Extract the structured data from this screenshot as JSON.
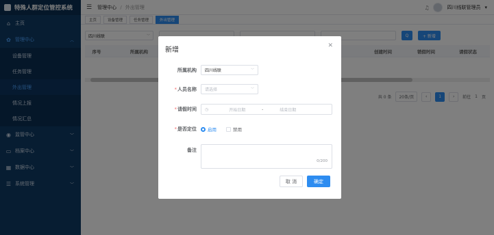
{
  "app": {
    "title": "特殊人群定位管控系统"
  },
  "sidebar": {
    "home": {
      "label": "主页",
      "icon": "home-icon"
    },
    "management": {
      "label": "管理中心",
      "icon": "gear-icon",
      "items": [
        {
          "label": "设备管理"
        },
        {
          "label": "任务管理"
        },
        {
          "label": "外出管理"
        },
        {
          "label": "情况上报"
        },
        {
          "label": "情况汇总"
        }
      ]
    },
    "groups": [
      {
        "label": "监管中心",
        "icon": "location-icon"
      },
      {
        "label": "档案中心",
        "icon": "folder-icon"
      },
      {
        "label": "数据中心",
        "icon": "grid-icon"
      },
      {
        "label": "系统管理",
        "icon": "settings-icon"
      }
    ]
  },
  "topbar": {
    "breadcrumb": [
      "管理中心",
      "外出管理"
    ],
    "user": "四川线联管理员"
  },
  "tags": [
    "主页",
    "设备管理",
    "任务管理",
    "外出管理"
  ],
  "filters": {
    "org": "四川线联",
    "search_label": "Q",
    "add_label": "+ 新增"
  },
  "table": {
    "columns": [
      "序号",
      "所属机构",
      "",
      "",
      "",
      "",
      "",
      "创建时间",
      "销假时间",
      "请假状态"
    ]
  },
  "pager": {
    "total": "共 0 条",
    "size": "20条/页",
    "page": "1",
    "goto_prefix": "前往",
    "goto_value": "1",
    "goto_suffix": "页"
  },
  "modal": {
    "title": "新增",
    "org_label": "所属机构",
    "org_value": "四川线联",
    "person_label": "人员名称",
    "person_placeholder": "请选择",
    "time_label": "请假时间",
    "start_placeholder": "开始日期",
    "end_placeholder": "结束日期",
    "date_sep": "-",
    "locate_label": "是否定位",
    "opt_enable": "启用",
    "opt_disable": "禁用",
    "remark_label": "备注",
    "remark_count": "0/200",
    "cancel_label": "取 消",
    "ok_label": "确定"
  },
  "colors": {
    "accent": "#2d8cf0",
    "sidebar": "#0f3a64",
    "required": "#f56c6c"
  }
}
